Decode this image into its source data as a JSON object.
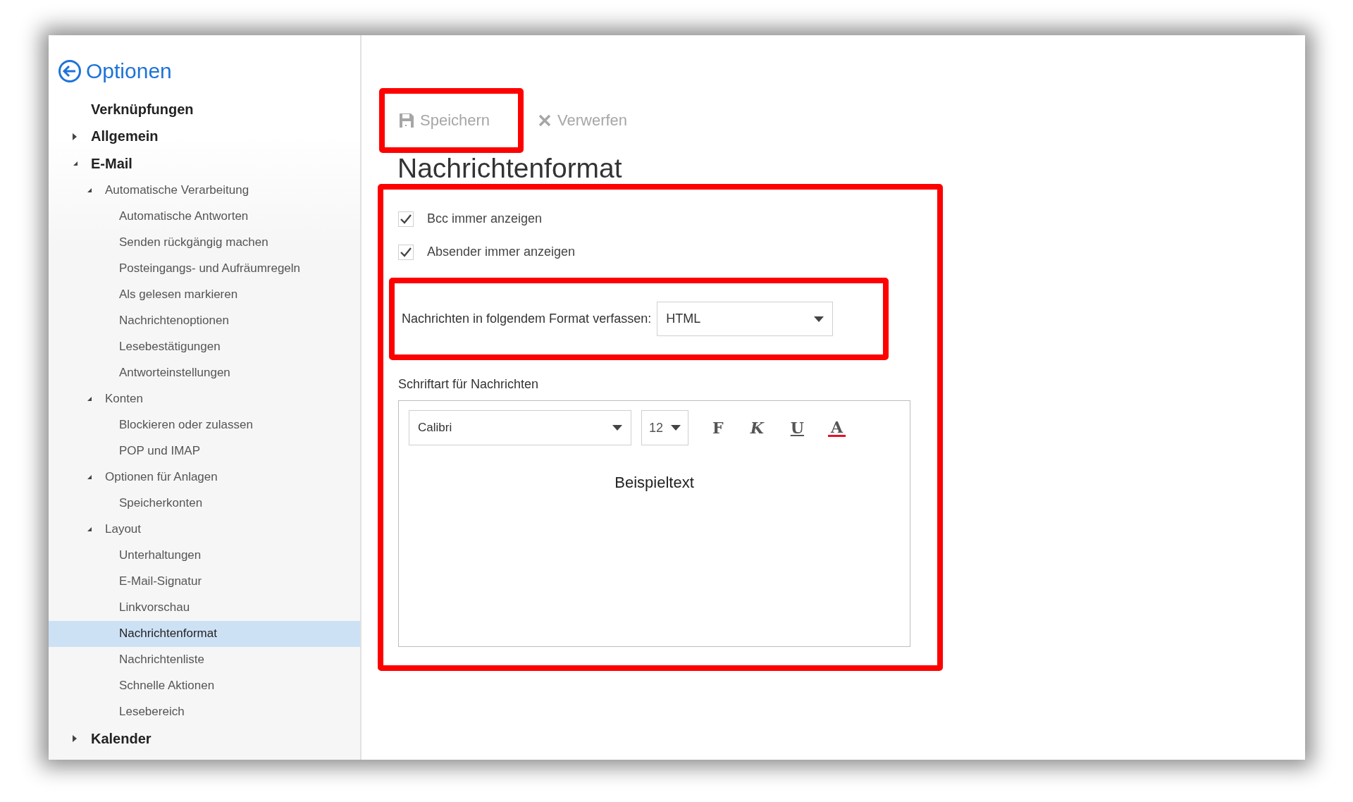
{
  "header": {
    "title": "Optionen"
  },
  "sidebar": {
    "items": [
      {
        "label": "Verknüpfungen",
        "selected": false
      },
      {
        "label": "Allgemein",
        "selected": false,
        "expanded": false
      },
      {
        "label": "E-Mail",
        "selected": false,
        "expanded": true,
        "children": [
          {
            "label": "Automatische Verarbeitung",
            "selected": false,
            "expanded": true,
            "children": [
              {
                "label": "Automatische Antworten",
                "selected": false
              },
              {
                "label": "Senden rückgängig machen",
                "selected": false
              },
              {
                "label": "Posteingangs- und Aufräumregeln",
                "selected": false
              },
              {
                "label": "Als gelesen markieren",
                "selected": false
              },
              {
                "label": "Nachrichtenoptionen",
                "selected": false
              },
              {
                "label": "Lesebestätigungen",
                "selected": false
              },
              {
                "label": "Antworteinstellungen",
                "selected": false
              }
            ]
          },
          {
            "label": "Konten",
            "selected": false,
            "expanded": true,
            "children": [
              {
                "label": "Blockieren oder zulassen",
                "selected": false
              },
              {
                "label": "POP und IMAP",
                "selected": false
              }
            ]
          },
          {
            "label": "Optionen für Anlagen",
            "selected": false,
            "expanded": true,
            "children": [
              {
                "label": "Speicherkonten",
                "selected": false
              }
            ]
          },
          {
            "label": "Layout",
            "selected": false,
            "expanded": true,
            "children": [
              {
                "label": "Unterhaltungen",
                "selected": false
              },
              {
                "label": "E-Mail-Signatur",
                "selected": false
              },
              {
                "label": "Linkvorschau",
                "selected": false
              },
              {
                "label": "Nachrichtenformat",
                "selected": true
              },
              {
                "label": "Nachrichtenliste",
                "selected": false
              },
              {
                "label": "Schnelle Aktionen",
                "selected": false
              },
              {
                "label": "Lesebereich",
                "selected": false
              }
            ]
          }
        ]
      },
      {
        "label": "Kalender",
        "selected": false,
        "expanded": false
      }
    ]
  },
  "toolbar": {
    "buttons": [
      {
        "kind": "save",
        "label": "Speichern",
        "disabled": true
      },
      {
        "kind": "discard",
        "label": "Verwerfen",
        "disabled": true
      }
    ]
  },
  "page_title": "Nachrichtenformat",
  "checkboxes": [
    {
      "label": "Bcc immer anzeigen",
      "checked": true
    },
    {
      "label": "Absender immer anzeigen",
      "checked": true
    }
  ],
  "compose_format": {
    "label": "Nachrichten in folgendem Format verfassen:",
    "value": "HTML"
  },
  "font_section": {
    "label": "Schriftart für Nachrichten",
    "font": "Calibri",
    "size": "12",
    "format_buttons": [
      {
        "kind": "bold",
        "label": "F"
      },
      {
        "kind": "italic",
        "label": "K"
      },
      {
        "kind": "underline",
        "label": "U"
      },
      {
        "kind": "color",
        "label": "A"
      }
    ],
    "sample": "Beispieltext"
  }
}
